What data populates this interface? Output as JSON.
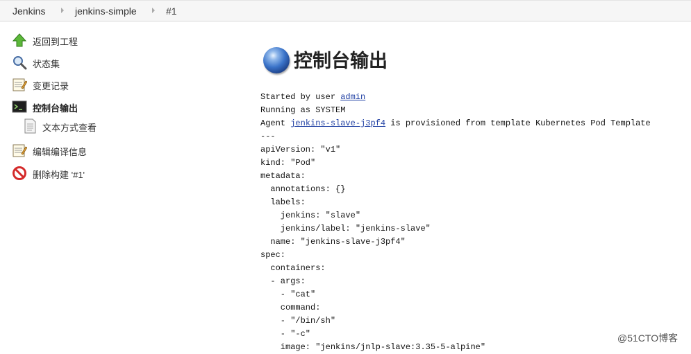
{
  "breadcrumb": [
    "Jenkins",
    "jenkins-simple",
    "#1"
  ],
  "sidebar": {
    "items": [
      {
        "label": "返回到工程",
        "icon": "up-arrow-icon"
      },
      {
        "label": "状态集",
        "icon": "magnifier-icon"
      },
      {
        "label": "变更记录",
        "icon": "notepad-icon"
      },
      {
        "label": "控制台输出",
        "icon": "terminal-icon",
        "active": true
      },
      {
        "label": "文本方式查看",
        "icon": "document-icon"
      },
      {
        "label": "编辑编译信息",
        "icon": "notepad-icon"
      },
      {
        "label": "删除构建 '#1'",
        "icon": "no-entry-icon"
      }
    ]
  },
  "main": {
    "title": "控制台输出",
    "console": {
      "started_prefix": "Started by user ",
      "user": "admin",
      "running": "Running as SYSTEM",
      "agent_prefix": "Agent ",
      "agent_name": "jenkins-slave-j3pf4",
      "agent_suffix": " is provisioned from template Kubernetes Pod Template",
      "yaml_lines": [
        "---",
        "apiVersion: \"v1\"",
        "kind: \"Pod\"",
        "metadata:",
        "  annotations: {}",
        "  labels:",
        "    jenkins: \"slave\"",
        "    jenkins/label: \"jenkins-slave\"",
        "  name: \"jenkins-slave-j3pf4\"",
        "spec:",
        "  containers:",
        "  - args:",
        "    - \"cat\"",
        "    command:",
        "    - \"/bin/sh\"",
        "    - \"-c\"",
        "    image: \"jenkins/jnlp-slave:3.35-5-alpine\""
      ]
    }
  },
  "watermark": "@51CTO博客",
  "colors": {
    "link": "#1f3fa3",
    "breadcrumb_bg": "#f6f6f6"
  }
}
